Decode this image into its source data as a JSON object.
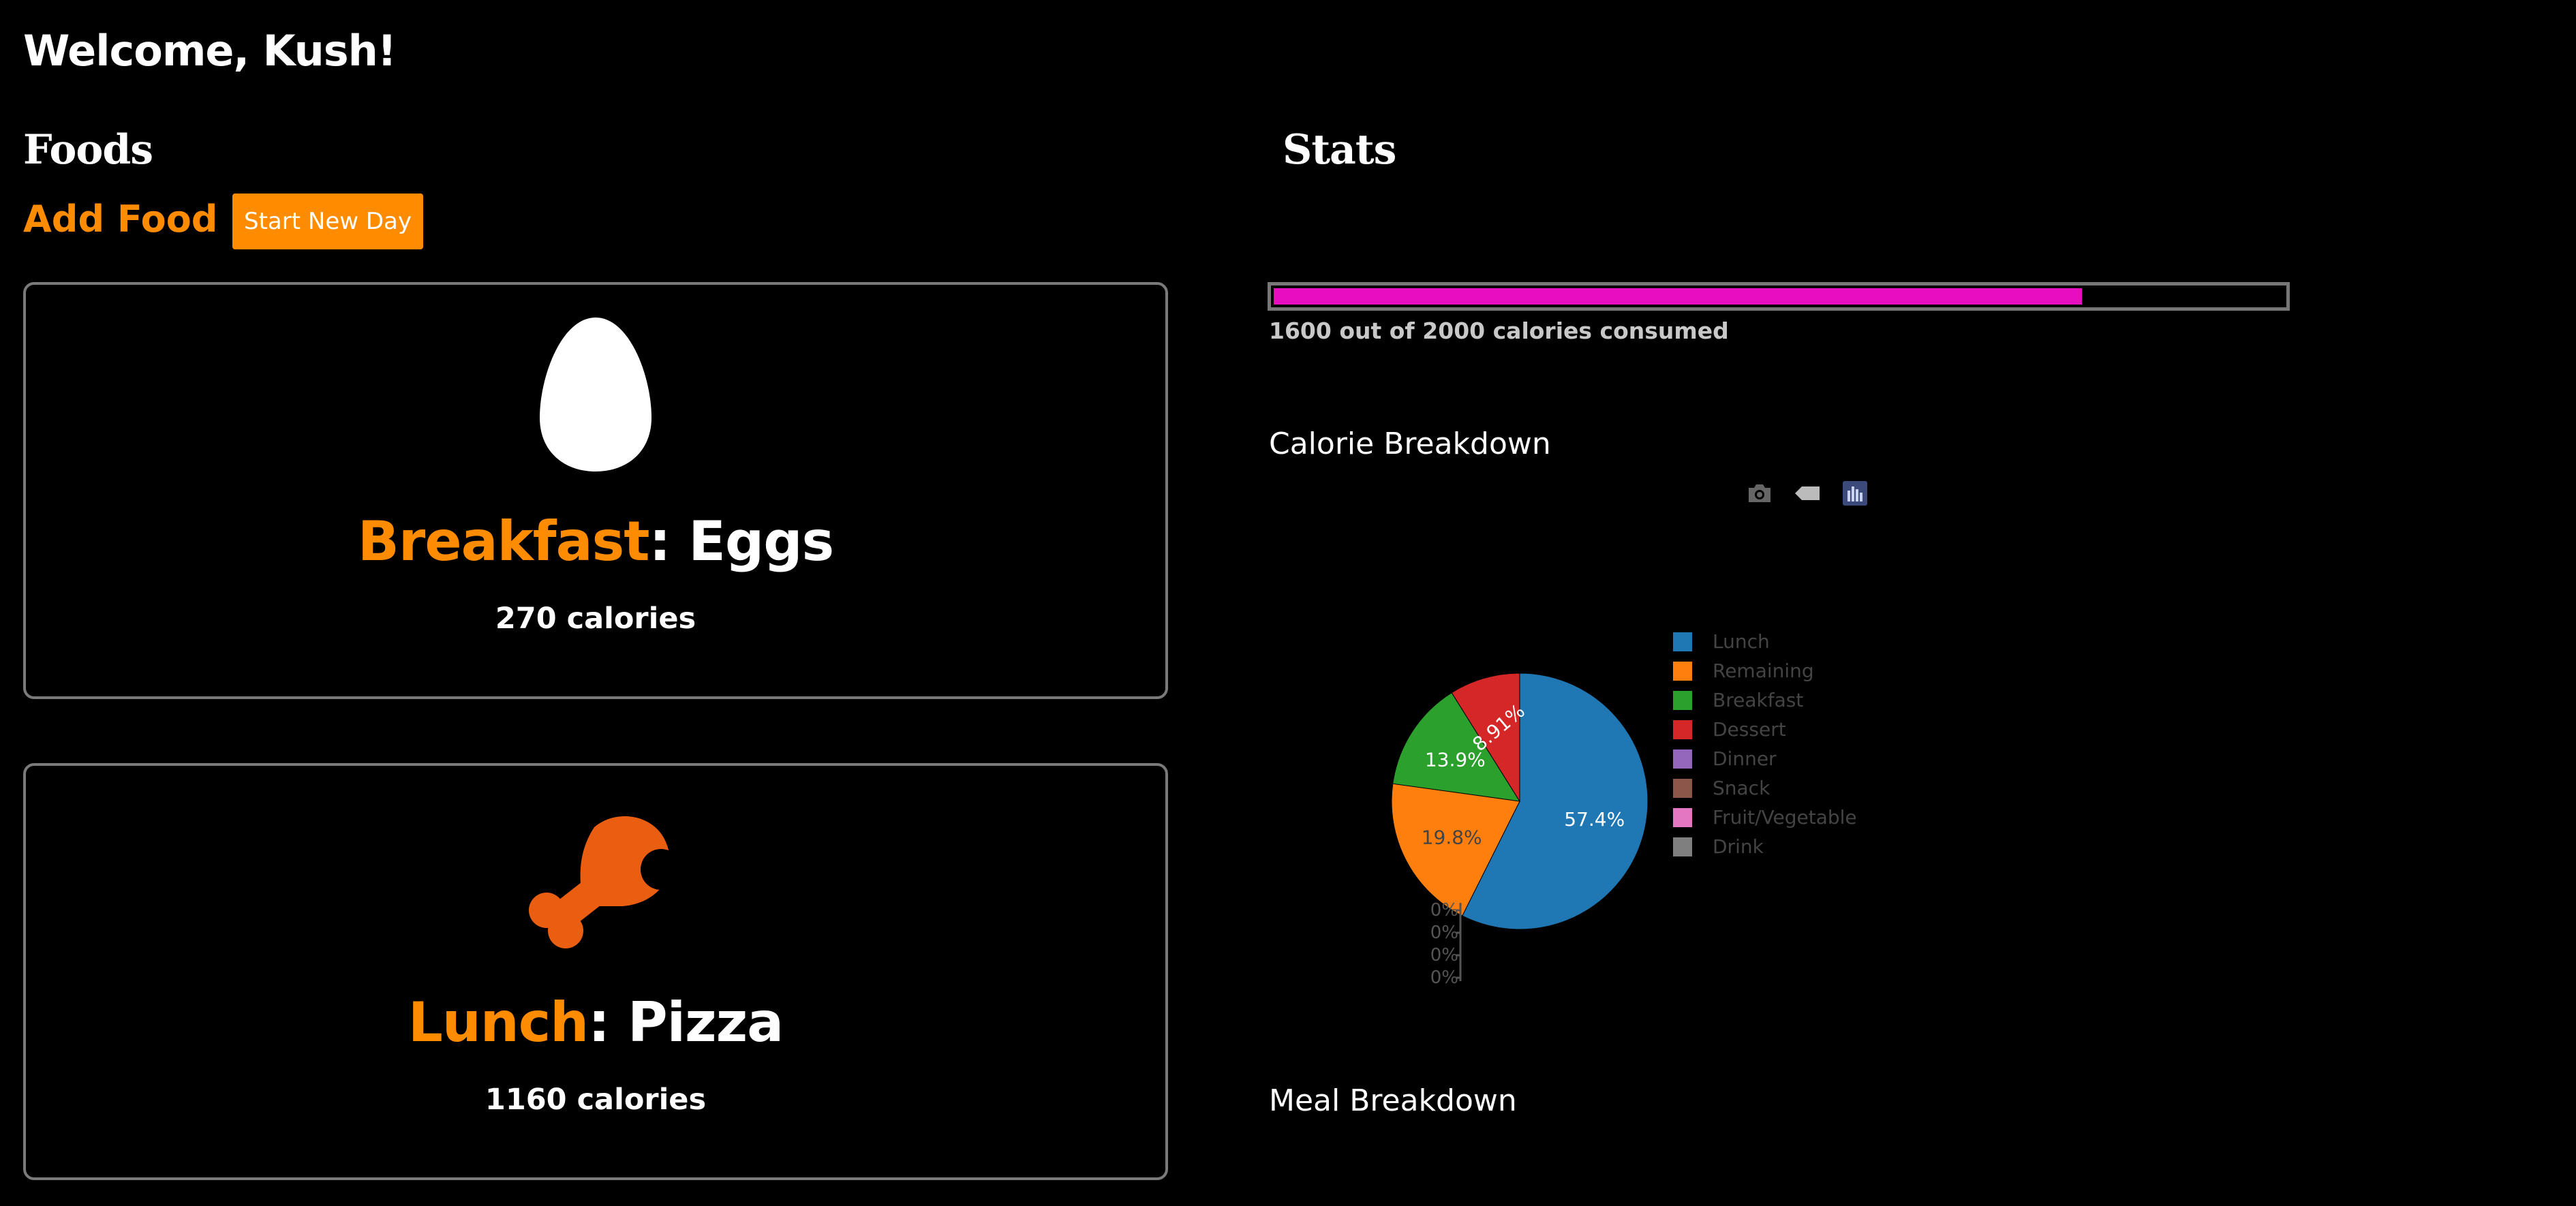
{
  "header": {
    "welcome": "Welcome, Kush!"
  },
  "foods": {
    "heading": "Foods",
    "add_food_label": "Add Food",
    "start_new_day_label": "Start New Day",
    "cards": [
      {
        "meal": "Breakfast",
        "separator": ": ",
        "food": "Eggs",
        "calories_text": "270 calories",
        "icon": "egg-icon",
        "icon_color": "#ffffff"
      },
      {
        "meal": "Lunch",
        "separator": ": ",
        "food": "Pizza",
        "calories_text": "1160 calories",
        "icon": "chicken-leg-icon",
        "icon_color": "#ea5e12"
      }
    ]
  },
  "stats": {
    "heading": "Stats",
    "progress": {
      "consumed": 1600,
      "goal": 2000,
      "text": "1600 out of 2000 calories consumed",
      "fill_color": "#e60ec0"
    },
    "calorie_breakdown_title": "Calorie Breakdown",
    "meal_breakdown_title": "Meal Breakdown",
    "modebar_icons": [
      "camera-icon",
      "tag-icon",
      "plotly-logo-icon"
    ],
    "axis_labels": [
      "0%",
      "0%",
      "0%",
      "0%"
    ]
  },
  "colors": {
    "accent": "#ff8c00",
    "background": "#000000"
  },
  "chart_data": {
    "type": "pie",
    "title": "Calorie Breakdown",
    "legend_placement": "right",
    "labels": [
      "Lunch",
      "Remaining",
      "Breakfast",
      "Dessert",
      "Dinner",
      "Snack",
      "Fruit/Vegetable",
      "Drink"
    ],
    "percent_labels": [
      "57.4%",
      "19.8%",
      "13.9%",
      "8.91%",
      "",
      "",
      "",
      ""
    ],
    "values": [
      57.4,
      19.8,
      13.9,
      8.91,
      0,
      0,
      0,
      0
    ],
    "colors": [
      "#1f77b4",
      "#ff7f0e",
      "#2ca02c",
      "#d62728",
      "#9467bd",
      "#8c564b",
      "#e377c2",
      "#7f7f7f"
    ]
  }
}
